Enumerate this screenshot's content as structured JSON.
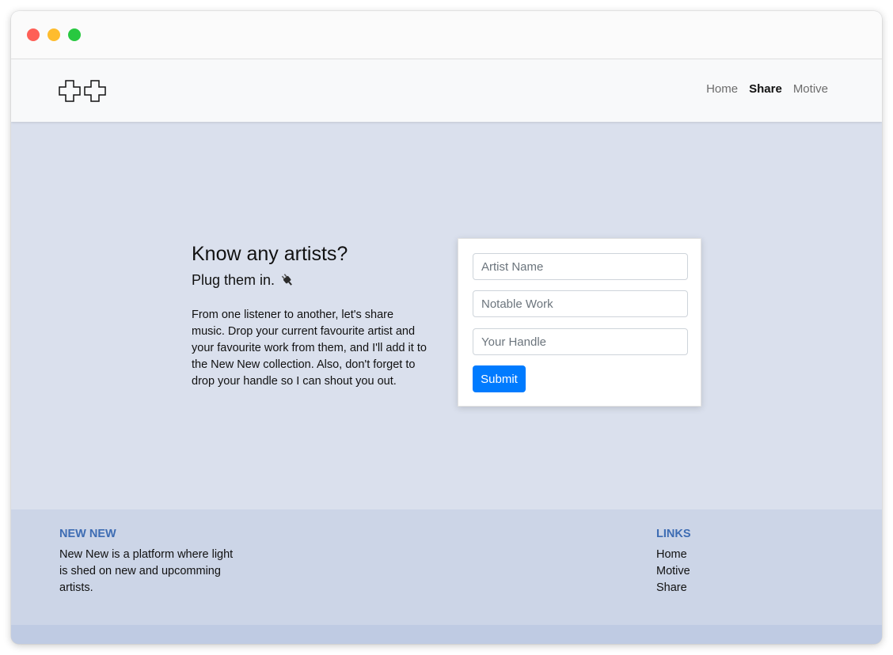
{
  "navbar": {
    "logo_icon": "double-cross-logo-icon",
    "links": [
      {
        "label": "Home",
        "active": false
      },
      {
        "label": "Share",
        "active": true
      },
      {
        "label": "Motive",
        "active": false
      }
    ]
  },
  "hero": {
    "title": "Know any artists?",
    "subtitle": "Plug them in.",
    "subtitle_icon": "plug-icon",
    "body": "From one listener to another, let's share music. Drop your current favourite artist and your favourite work from them, and I'll add it to the New New collection. Also, don't forget to drop your handle so I can shout you out."
  },
  "form": {
    "artist_placeholder": "Artist Name",
    "work_placeholder": "Notable Work",
    "handle_placeholder": "Your Handle",
    "submit_label": "Submit"
  },
  "footer": {
    "about_heading": "NEW NEW",
    "about_text": "New New is a platform where light is shed on new and upcomming artists.",
    "links_heading": "LINKS",
    "links": [
      "Home",
      "Motive",
      "Share"
    ]
  },
  "colors": {
    "page_bg": "#dae0ed",
    "footer_bg": "#ccd5e7",
    "accent": "#007bff",
    "footer_heading": "#3d6cb3"
  }
}
